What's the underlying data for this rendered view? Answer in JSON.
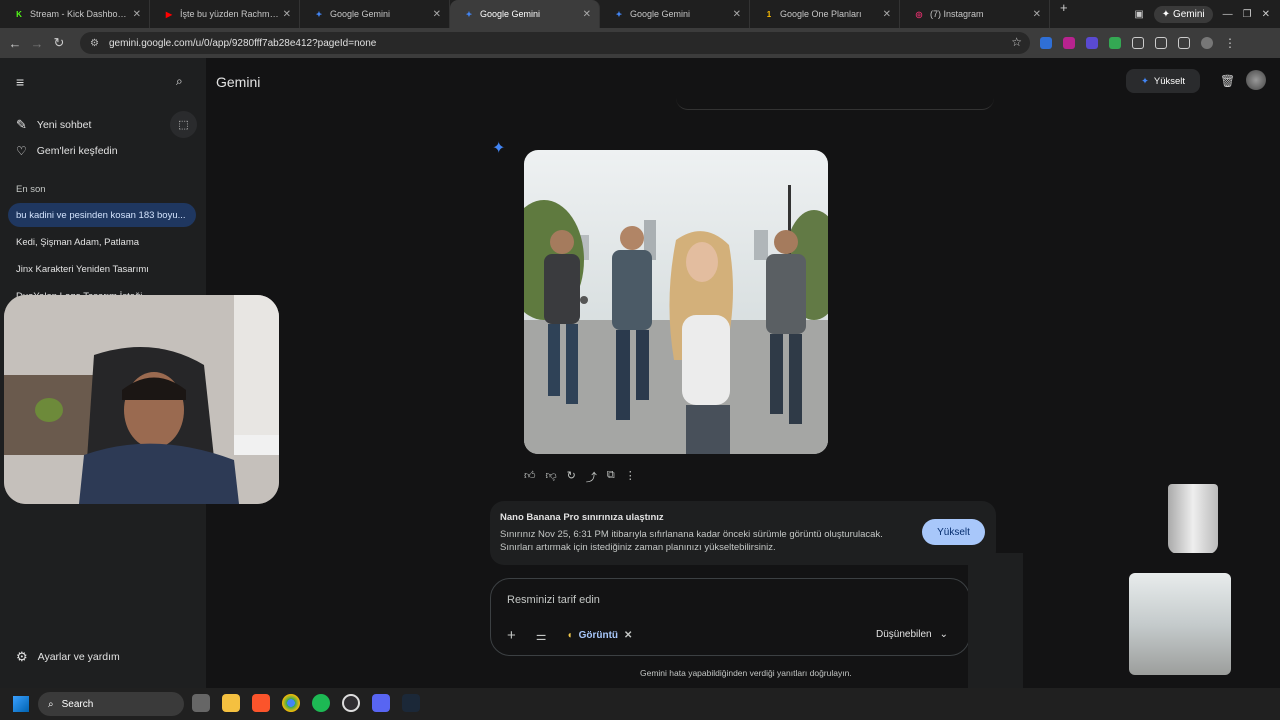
{
  "browser": {
    "tabs": [
      {
        "title": "Stream - Kick Dashboard",
        "fav_color": "#53fc18",
        "fav_text": "K"
      },
      {
        "title": "İşte bu yüzden Rachmaninoff",
        "fav_color": "#ff0000",
        "fav_text": "▶"
      },
      {
        "title": "Google Gemini",
        "fav_color": "#4285f4",
        "fav_text": "✦"
      },
      {
        "title": "Google Gemini",
        "fav_color": "#4285f4",
        "fav_text": "✦"
      },
      {
        "title": "Google Gemini",
        "fav_color": "#4285f4",
        "fav_text": "✦"
      },
      {
        "title": "Google One Planları",
        "fav_color": "#fbbc04",
        "fav_text": "1"
      },
      {
        "title": "(7) Instagram",
        "fav_color": "#e1306c",
        "fav_text": "◎"
      }
    ],
    "active_tab_index": 3,
    "new_tab": "+",
    "gemini_pill": "✦ Gemini",
    "url": "gemini.google.com/u/0/app/9280fff7ab28e412?pageId=none"
  },
  "sidebar": {
    "new_chat": "Yeni sohbet",
    "explore_gems": "Gem'leri keşfedin",
    "recent_heading": "En son",
    "recent": [
      {
        "label": "bu kadini ve pesinden kosan 183 boyu...",
        "selected": true
      },
      {
        "label": "Kedi, Şişman Adam, Patlama",
        "selected": false
      },
      {
        "label": "Jinx Karakteri Yeniden Tasarımı",
        "selected": false
      },
      {
        "label": "DuoYalan Logo Tasarım İsteği",
        "selected": false
      }
    ],
    "settings": "Ayarlar ve yardım"
  },
  "main": {
    "title": "Gemini",
    "upgrade_top": "Yükselt",
    "notice": {
      "title": "Nano Banana Pro sınırınıza ulaştınız",
      "body": "Sınırınız Nov 25, 6:31 PM itibarıyla sıfırlanana kadar önceki sürümle görüntü oluşturulacak. Sınırları artırmak için istediğiniz zaman planınızı yükseltebilirsiniz.",
      "button": "Yükselt"
    },
    "composer": {
      "placeholder": "Resminizi tarif edin",
      "chip": "Görüntü",
      "mode": "Düşünebilen"
    },
    "disclaimer": "Gemini hata yapabildiğinden verdiği yanıtları doğrulayın."
  },
  "taskbar": {
    "search": "Search"
  }
}
